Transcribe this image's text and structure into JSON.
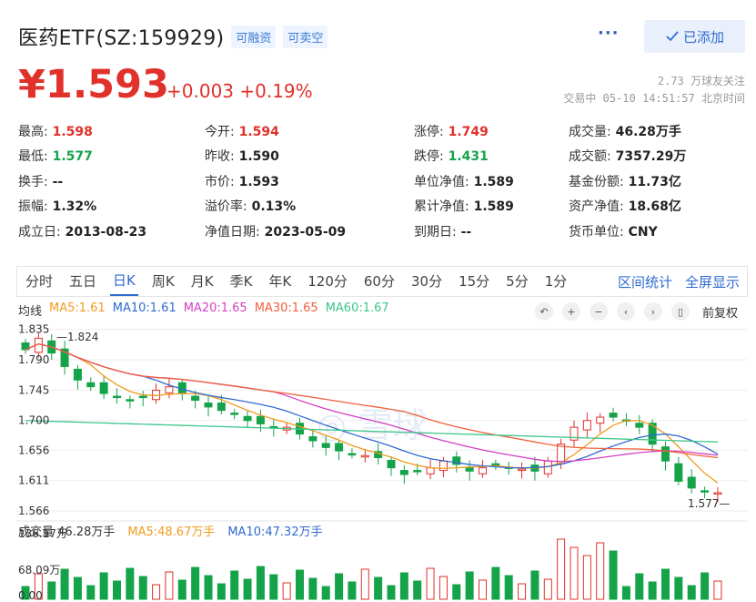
{
  "header": {
    "title": "医药ETF(SZ:159929)",
    "tags": [
      "可融资",
      "可卖空"
    ],
    "more": "···",
    "added_label": "已添加"
  },
  "quote": {
    "price": "¥1.593",
    "change": "+0.003 +0.19%",
    "followers": "2.73 万球友关注",
    "status": "交易中 05-10 14:51:57 北京时间"
  },
  "stats": [
    [
      {
        "label": "最高:",
        "value": "1.598",
        "color": "red"
      },
      {
        "label": "今开:",
        "value": "1.594",
        "color": "red"
      },
      {
        "label": "涨停:",
        "value": "1.749",
        "color": "red"
      },
      {
        "label": "成交量:",
        "value": "46.28万手"
      }
    ],
    [
      {
        "label": "最低:",
        "value": "1.577",
        "color": "green"
      },
      {
        "label": "昨收:",
        "value": "1.590"
      },
      {
        "label": "跌停:",
        "value": "1.431",
        "color": "green"
      },
      {
        "label": "成交额:",
        "value": "7357.29万"
      }
    ],
    [
      {
        "label": "换手:",
        "value": "--"
      },
      {
        "label": "市价:",
        "value": "1.593"
      },
      {
        "label": "单位净值:",
        "value": "1.589"
      },
      {
        "label": "基金份额:",
        "value": "11.73亿"
      }
    ],
    [
      {
        "label": "振幅:",
        "value": "1.32%"
      },
      {
        "label": "溢价率:",
        "value": "0.13%"
      },
      {
        "label": "累计净值:",
        "value": "1.589"
      },
      {
        "label": "资产净值:",
        "value": "18.68亿"
      }
    ],
    [
      {
        "label": "成立日:",
        "value": "2013-08-23"
      },
      {
        "label": "净值日期:",
        "value": "2023-05-09"
      },
      {
        "label": "到期日:",
        "value": "--"
      },
      {
        "label": "货币单位:",
        "value": "CNY"
      }
    ]
  ],
  "tabs": {
    "items": [
      "分时",
      "五日",
      "日K",
      "周K",
      "月K",
      "季K",
      "年K",
      "120分",
      "60分",
      "30分",
      "15分",
      "5分",
      "1分"
    ],
    "active": "日K",
    "range_stats": "区间统计",
    "fullscreen": "全屏显示"
  },
  "ma": {
    "label": "均线",
    "items": [
      {
        "text": "MA5:1.61",
        "color": "#f29a1f"
      },
      {
        "text": "MA10:1.61",
        "color": "#2f6bd0"
      },
      {
        "text": "MA20:1.65",
        "color": "#d43fc4"
      },
      {
        "text": "MA30:1.65",
        "color": "#f0603c"
      },
      {
        "text": "MA60:1.67",
        "color": "#3cc58a"
      }
    ]
  },
  "controls": {
    "icons": [
      "undo-icon",
      "zoom-in-icon",
      "zoom-out-icon",
      "prev-icon",
      "next-icon",
      "candle-icon"
    ],
    "restore": "前复权"
  },
  "price_axis": [
    "1.835",
    "1.790",
    "1.745",
    "1.700",
    "1.656",
    "1.611",
    "1.566"
  ],
  "annotations": {
    "high": "1.824",
    "low": "1.577"
  },
  "watermark": "雪球",
  "volume": {
    "label": "成交量 46.28万手",
    "ma5": "MA5:48.67万手",
    "ma10": "MA10:47.32万手",
    "axis": [
      "136.17万",
      "68.09万",
      "0.00"
    ]
  },
  "colors": {
    "up": "#e0312a",
    "down": "#15a34a",
    "accent": "#2f6bd0"
  }
}
